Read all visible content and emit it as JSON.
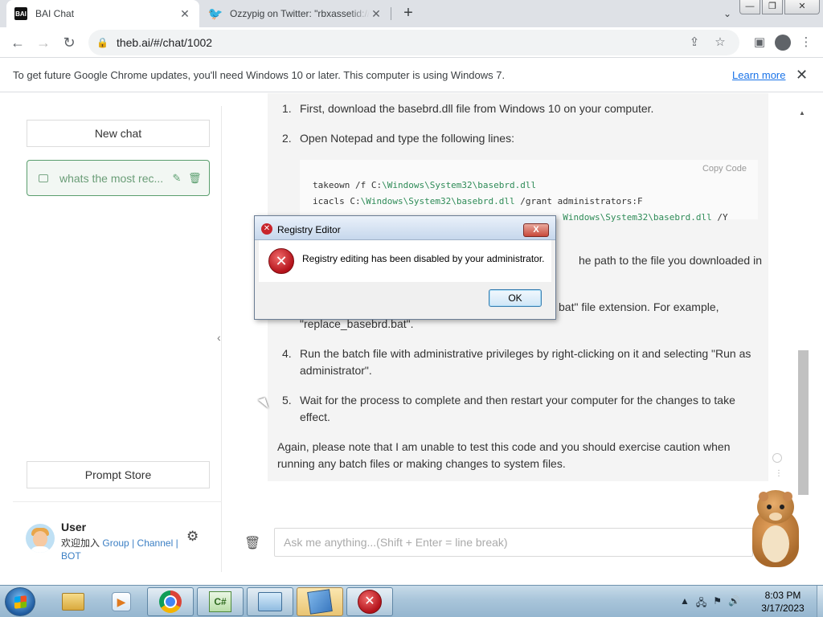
{
  "browser": {
    "tabs": [
      {
        "title": "BAI Chat",
        "favicon": "bai-logo",
        "active": true
      },
      {
        "title": "Ozzypig on Twitter: \"rbxassetid://",
        "favicon": "twitter-bird",
        "active": false
      }
    ],
    "url": "theb.ai/#/chat/1002",
    "infobar": {
      "text": "To get future Google Chrome updates, you'll need Windows 10 or later. This computer is using Windows 7.",
      "link": "Learn more"
    }
  },
  "sidebar": {
    "new_chat": "New chat",
    "chat_item": "whats the most rec...",
    "prompt_store": "Prompt Store",
    "user": {
      "name": "User",
      "welcome": "欢迎加入",
      "group": "Group",
      "channel": "Channel",
      "bot": "BOT",
      "sep": "|"
    }
  },
  "chat": {
    "steps": [
      {
        "num": "1.",
        "text": "First, download the basebrd.dll file from Windows 10 on your computer."
      },
      {
        "num": "2.",
        "text": "Open Notepad and type the following lines:"
      },
      {
        "num": "3.",
        "text_a": "he path to the file you downloaded in",
        "text_b": "bat\" file extension. For example,",
        "text_c": "\"replace_basebrd.bat\"."
      },
      {
        "num": "4.",
        "line1": "Run the batch file with administrative privileges by right-clicking on it and selecting \"Run as",
        "line2": "administrator\"."
      },
      {
        "num": "5.",
        "line1": "Wait for the process to complete and then restart your computer for the changes to take",
        "line2": "effect."
      }
    ],
    "code": {
      "copy_label": "Copy  Code",
      "lines": [
        {
          "pre": "takeown /f C:",
          "path": "\\Windows\\System32\\basebrd.dll",
          "post": ""
        },
        {
          "pre": "icacls C:",
          "path": "\\Windows\\System32\\basebrd.dll",
          "post": " /grant administrators:F"
        },
        {
          "pre": "",
          "path": "Windows\\System32\\basebrd.dll",
          "post": " /Y"
        }
      ]
    },
    "closing_line1": "Again, please note that I am unable to test this code and you should exercise caution when",
    "closing_line2": "running any batch files or making changes to system files.",
    "input_placeholder": "Ask me anything...(Shift + Enter = line break)"
  },
  "dialog": {
    "title": "Registry Editor",
    "message": "Registry editing has been disabled by your administrator.",
    "ok": "OK",
    "close": "X",
    "icon": "error-icon"
  },
  "taskbar": {
    "apps": [
      "windows-explorer",
      "windows-media-player",
      "google-chrome",
      "visual-csharp",
      "control-panel",
      "registry-editor",
      "error-dialog"
    ],
    "time": "8:03 PM",
    "date": "3/17/2023"
  }
}
